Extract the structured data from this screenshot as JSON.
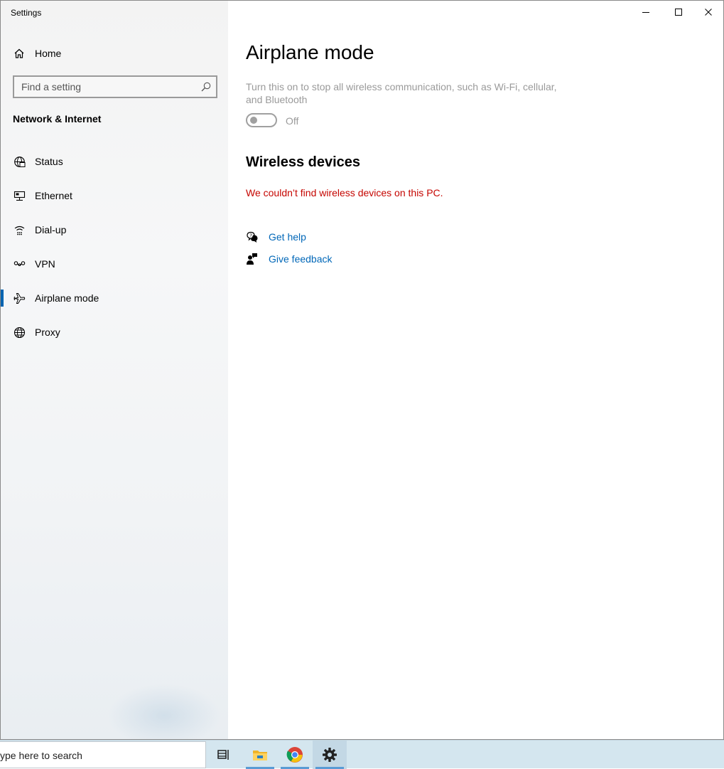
{
  "window": {
    "title": "Settings"
  },
  "sidebar": {
    "home_label": "Home",
    "search_placeholder": "Find a setting",
    "section_title": "Network & Internet",
    "items": [
      {
        "label": "Status",
        "icon": "status-globe-icon"
      },
      {
        "label": "Ethernet",
        "icon": "ethernet-icon"
      },
      {
        "label": "Dial-up",
        "icon": "dial-up-icon"
      },
      {
        "label": "VPN",
        "icon": "vpn-icon"
      },
      {
        "label": "Airplane mode",
        "icon": "airplane-icon",
        "selected": true
      },
      {
        "label": "Proxy",
        "icon": "proxy-globe-icon"
      }
    ]
  },
  "main": {
    "title": "Airplane mode",
    "description": "Turn this on to stop all wireless communication, such as Wi-Fi, cellular, and Bluetooth",
    "toggle_state": "Off",
    "wireless_title": "Wireless devices",
    "wireless_error": "We couldn’t find wireless devices on this PC.",
    "get_help": "Get help",
    "give_feedback": "Give feedback"
  },
  "taskbar": {
    "search_text": "ype here to search",
    "apps": [
      "task-view-icon",
      "file-explorer-icon",
      "chrome-icon",
      "settings-gear-icon"
    ]
  },
  "colors": {
    "accent": "#0063b1",
    "link": "#0067b8",
    "error": "#c50500",
    "disabled": "#9a9a9a"
  }
}
